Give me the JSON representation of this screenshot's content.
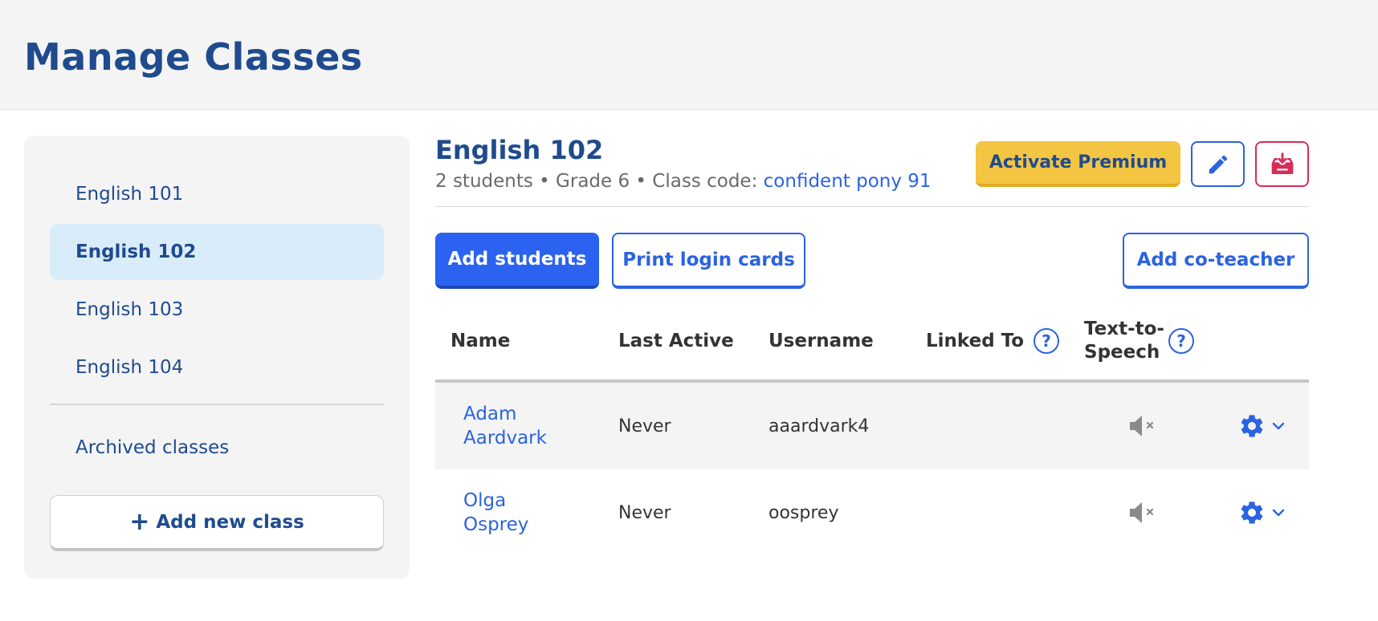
{
  "page": {
    "title": "Manage Classes"
  },
  "sidebar": {
    "items": [
      {
        "label": "English 101"
      },
      {
        "label": "English 102",
        "active": true
      },
      {
        "label": "English 103"
      },
      {
        "label": "English 104"
      }
    ],
    "archived_label": "Archived classes",
    "add_class_plus": "+",
    "add_class_label": "Add new class"
  },
  "class_header": {
    "name": "English 102",
    "meta_prefix": "2 students • Grade 6 • Class code: ",
    "class_code": "confident pony 91"
  },
  "actions": {
    "premium": "Activate Premium",
    "edit_icon": "pencil-icon",
    "archive_icon": "archive-download-icon",
    "add_students": "Add students",
    "print_cards": "Print login cards",
    "add_coteacher": "Add co-teacher"
  },
  "table": {
    "columns": {
      "name": "Name",
      "last_active": "Last Active",
      "username": "Username",
      "linked_to": "Linked To",
      "tts": "Text-to-Speech"
    },
    "help_glyph": "?",
    "rows": [
      {
        "first": "Adam",
        "last": "Aardvark",
        "last_active": "Never",
        "username": "aaardvark4",
        "tts": "muted"
      },
      {
        "first": "Olga",
        "last": "Osprey",
        "last_active": "Never",
        "username": "oosprey",
        "tts": "muted"
      }
    ]
  },
  "colors": {
    "brand_navy": "#1f4b8e",
    "accent_blue": "#2b63e0",
    "premium_yellow": "#f4c542",
    "danger_red": "#d62d58",
    "active_item_bg": "#d9ecfa"
  }
}
